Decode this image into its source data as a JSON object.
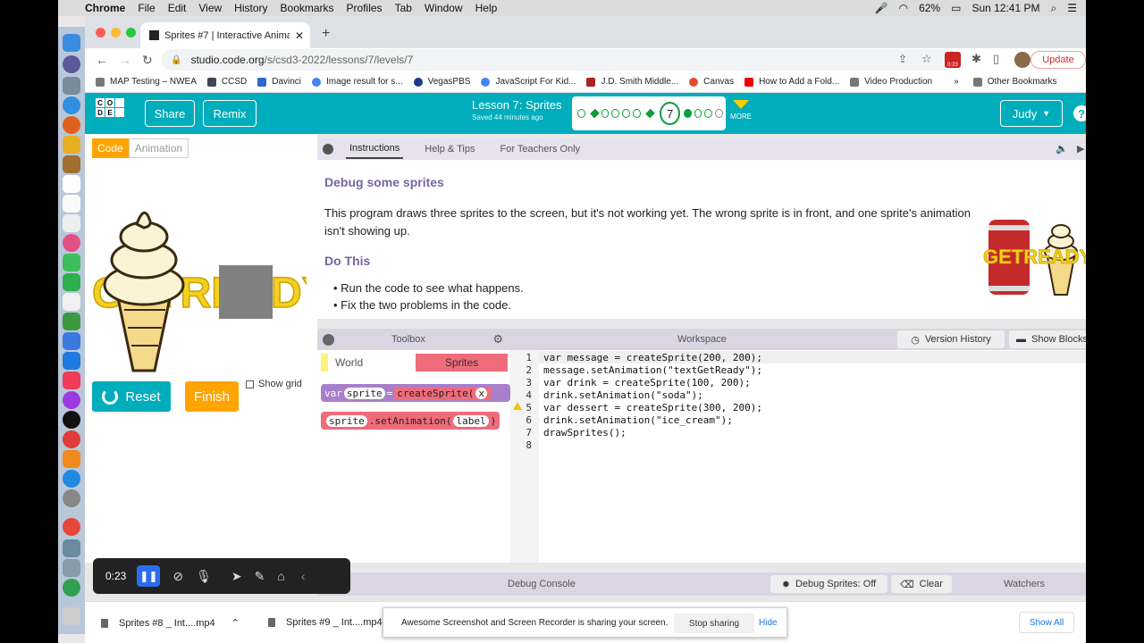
{
  "menubar": {
    "app": "Chrome",
    "items": [
      "File",
      "Edit",
      "View",
      "History",
      "Bookmarks",
      "Profiles",
      "Tab",
      "Window",
      "Help"
    ],
    "battery": "62%",
    "clock": "Sun 12:41 PM"
  },
  "browser": {
    "tab_title": "Sprites #7 | Interactive Animati",
    "url_host": "studio.code.org",
    "url_path": "/s/csd3-2022/lessons/7/levels/7",
    "update_label": "Update",
    "rec_badge": "0:23",
    "bookmarks": [
      "MAP Testing – NWEA",
      "CCSD",
      "Davinci",
      "Image result for s...",
      "VegasPBS",
      "JavaScript For Kid...",
      "J.D. Smith Middle...",
      "Canvas",
      "How to Add a Fold...",
      "Video Production"
    ],
    "bookmarks_more": "»",
    "other_bookmarks": "Other Bookmarks"
  },
  "header": {
    "logo_letters": [
      "C",
      "O",
      "",
      "D",
      "E",
      ""
    ],
    "share_label": "Share",
    "remix_label": "Remix",
    "lesson_title": "Lesson 7: Sprites",
    "saved_text": "Saved 44 minutes ago",
    "current_level": "7",
    "more_label": "MORE",
    "user_label": "Judy",
    "help_label": "?"
  },
  "left": {
    "code_tab": "Code",
    "animation_tab": "Animation",
    "reset_label": "Reset",
    "finish_label": "Finish",
    "show_grid_label": "Show grid"
  },
  "instructions": {
    "tabs": [
      "Instructions",
      "Help & Tips",
      "For Teachers Only"
    ],
    "heading1": "Debug some sprites",
    "body": "This program draws three sprites to the screen, but it's not working yet. The wrong sprite is in front, and one sprite's animation isn't showing up.",
    "heading2": "Do This",
    "bullets": [
      "Run the code to see what happens.",
      "Fix the two problems in the code."
    ]
  },
  "toolbox": {
    "title": "Toolbox",
    "cat_world": "World",
    "cat_sprites": "Sprites",
    "block1": {
      "var": "var",
      "name": "sprite",
      "eq": "=",
      "fn": "createSprite(",
      "arg": "x"
    },
    "block2": {
      "name": "sprite",
      "fn": ".setAnimation(",
      "arg": "label",
      "close": ")"
    }
  },
  "workspace": {
    "title": "Workspace",
    "version_history": "Version History",
    "show_blocks": "Show Blocks",
    "line_numbers": [
      "1",
      "2",
      "3",
      "4",
      "5",
      "6",
      "7",
      "8"
    ],
    "lines": [
      "var message = createSprite(200, 200);",
      "message.setAnimation(\"textGetReady\");",
      "var drink = createSprite(100, 200);",
      "drink.setAnimation(\"soda\");",
      "var dessert = createSprite(300, 200);",
      "drink.setAnimation(\"ice_cream\");",
      "drawSprites();",
      ""
    ]
  },
  "debug": {
    "console_title": "Debug Console",
    "debug_sprites": "Debug Sprites: Off",
    "clear_label": "Clear",
    "watchers": "Watchers"
  },
  "recorder": {
    "time": "0:23"
  },
  "downloads": {
    "file1": "Sprites #8 _ Int....mp4",
    "file2": "Sprites #9 _ Int....mp4",
    "notice": "Awesome Screenshot and Screen Recorder is sharing your screen.",
    "stop_sharing": "Stop sharing",
    "hide": "Hide",
    "show_all": "Show All"
  },
  "colors": {
    "codeorg_teal": "#00adbc",
    "orange": "#ffa400",
    "purple_heading": "#7665a0",
    "sprites_category": "#ef6c7a",
    "progress_green": "#0a9e3b"
  }
}
